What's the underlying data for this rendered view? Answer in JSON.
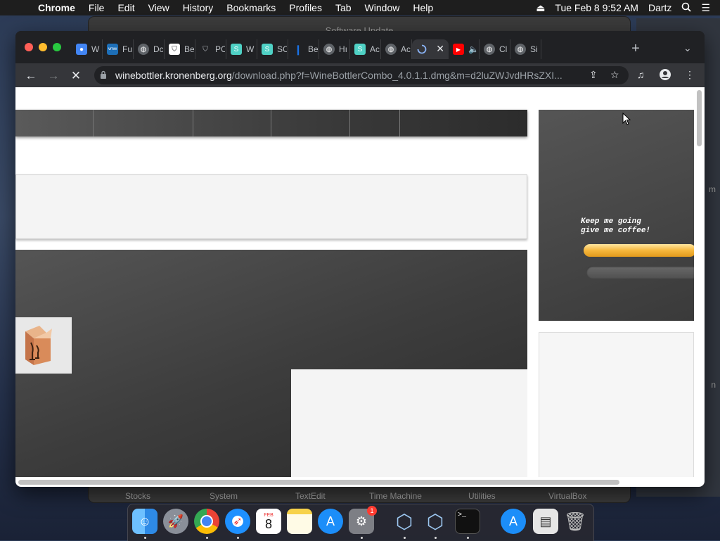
{
  "menubar": {
    "app": "Chrome",
    "items": [
      "File",
      "Edit",
      "View",
      "History",
      "Bookmarks",
      "Profiles",
      "Tab",
      "Window",
      "Help"
    ],
    "datetime": "Tue Feb 8  9:52 AM",
    "user": "Dartz"
  },
  "background_window": {
    "title": "Software Update",
    "labels": [
      "Stocks",
      "System",
      "TextEdit",
      "Time Machine",
      "Utilities",
      "VirtualBox"
    ],
    "side_labels": [
      "m",
      "n"
    ]
  },
  "browser": {
    "tabs": [
      {
        "label": "W",
        "favicon": "chrome-icon",
        "color": "#4285f4"
      },
      {
        "label": "Fu",
        "favicon": "vmw-icon",
        "color": "#1d6fb8"
      },
      {
        "label": "Dc",
        "favicon": "globe-icon",
        "color": "#5f6368"
      },
      {
        "label": "Be",
        "favicon": "shield-icon",
        "color": "#202124"
      },
      {
        "label": "PC",
        "favicon": "shield-outline-icon",
        "color": "#5f6368"
      },
      {
        "label": "W",
        "favicon": "s-icon",
        "color": "#4fd1c5"
      },
      {
        "label": "SC",
        "favicon": "s-icon",
        "color": "#4fd1c5"
      },
      {
        "label": "Be",
        "favicon": "feather-icon",
        "color": "#1a73e8"
      },
      {
        "label": "Hı",
        "favicon": "globe-icon",
        "color": "#5f6368"
      },
      {
        "label": "Ac",
        "favicon": "s-icon",
        "color": "#4fd1c5"
      },
      {
        "label": "Ac",
        "favicon": "globe-icon",
        "color": "#5f6368"
      },
      {
        "label": "",
        "favicon": "loading-spinner-icon",
        "color": "#8ab4f8",
        "active": true
      },
      {
        "label": "",
        "favicon": "youtube-icon",
        "color": "#ff0000"
      },
      {
        "label": "Cl",
        "favicon": "globe-icon",
        "color": "#5f6368"
      },
      {
        "label": "Si",
        "favicon": "globe-icon",
        "color": "#5f6368"
      }
    ],
    "url_host": "winebottler.kronenberg.org",
    "url_path": "/download.php?f=WineBottlerCombo_4.0.1.1.dmg&m=d2luZWJvdHRsZXI...",
    "active_tab_close": "✕",
    "new_tab": "+"
  },
  "page": {
    "coffee_line1": "Keep me going",
    "coffee_line2": "give me coffee!"
  },
  "dock": {
    "apps": [
      "Finder",
      "Launchpad",
      "Chrome",
      "Safari",
      "Calendar",
      "Notes",
      "App Store",
      "System Preferences",
      "VirtualBox",
      "VirtualBox",
      "Terminal",
      "App Store",
      "Archive",
      "Trash"
    ],
    "calendar_month": "FEB",
    "calendar_day": "8",
    "sysprefs_badge": "1"
  }
}
